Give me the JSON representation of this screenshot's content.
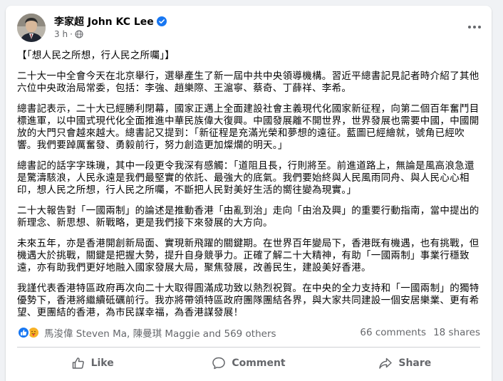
{
  "post": {
    "author": "李家超 John KC Lee",
    "time": "3 h",
    "paragraphs": [
      "【「想人民之所想，行人民之所囑」】",
      "二十大一中全會今天在北京舉行，選舉產生了新一屆中共中央領導機構。習近平總書記見記者時介紹了其他六位中央政治局常委，包括：李強、趙樂際、王滬寧、蔡奇、丁薛祥、李希。",
      "總書記表示，二十大已經勝利閉幕，國家正邁上全面建設社會主義現代化國家新征程，向第二個百年奮鬥目標進軍，以中國式現代化全面推進中華民族偉大復興。中國發展離不開世界，世界發展也需要中國，中國開放的大門只會越來越大。總書記又提到：「新征程是充滿光榮和夢想的遠征。藍圖已經繪就，號角已經吹響。我們要踔厲奮發、勇毅前行，努力創造更加燦爛的明天。」",
      "總書記的話字字珠璣，其中一段更令我深有感觸：「道阻且長，行則將至。前進道路上，無論是風高浪急還是驚濤駭浪，人民永遠是我們最堅實的依託、最強大的底氣。我們要始終與人民風雨同舟、與人民心心相印，想人民之所想，行人民之所囑，不斷把人民對美好生活的嚮往變為現實。」",
      "二十大報告對「一國兩制」的論述是推動香港「由亂到治」走向「由治及興」的重要行動指南，當中提出的新理念、新思想、新戰略，更是我們接下來發展的大方向。",
      "未來五年，亦是香港開創新局面、實現新飛躍的關鍵期。在世界百年變局下，香港既有機遇，也有挑戰，但機遇大於挑戰，關鍵是把握大勢，提升自身競爭力。正確了解二十大精神，有助「一國兩制」事業行穩致遠，亦有助我們更好地融入國家發展大局，聚焦發展，改善民生，建設美好香港。",
      "我謹代表香港特區政府再次向二十大取得圓滿成功致以熱烈祝賀。在中央的全力支持和「一國兩制」的獨特優勢下，香港將繼續砥礪前行。我亦將帶領特區政府團隊團結各界，與大家共同建設一個安居樂業、更有希望、更團結的香港，為市民謀幸福，為香港謀發展！"
    ]
  },
  "stats": {
    "reactors": "馬浚偉 Steven Ma, 陳曼琪 Maggie and 569 others",
    "comments": "66 comments",
    "shares": "18 shares"
  },
  "actions": {
    "like": "Like",
    "comment": "Comment",
    "share": "Share"
  },
  "colors": {
    "accent": "#1877f2",
    "secondary_text": "#65676b",
    "background": "#f0f2f5"
  }
}
